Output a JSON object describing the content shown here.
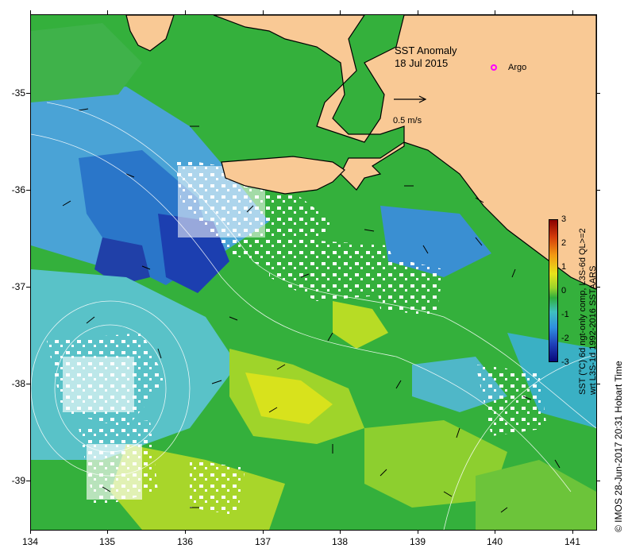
{
  "map": {
    "title": "SST Anomaly",
    "date": "18 Jul 2015",
    "legend_argo": "Argo",
    "vector_scale_label": "0.5 m/s",
    "y_ticks": [
      "-35",
      "-36",
      "-37",
      "-38",
      "-39"
    ],
    "x_ticks": [
      "134",
      "135",
      "136",
      "137",
      "138",
      "139",
      "140",
      "141"
    ],
    "land_color": "#f9c995",
    "argo_color": "#ff00ff"
  },
  "colorbar": {
    "ticks": [
      "3",
      "2",
      "1",
      "0",
      "-1",
      "-2",
      "-3"
    ],
    "caption_line1": "SST (°C) 6d ngt-only comp, L3S-6d QL>=2",
    "caption_line2": "wrt L3S-1d 1992-2016 SSTAARS",
    "range": [
      -3,
      3
    ]
  },
  "credit": "© IMOS 28-Jun-2017 20:31 Hobart Time"
}
